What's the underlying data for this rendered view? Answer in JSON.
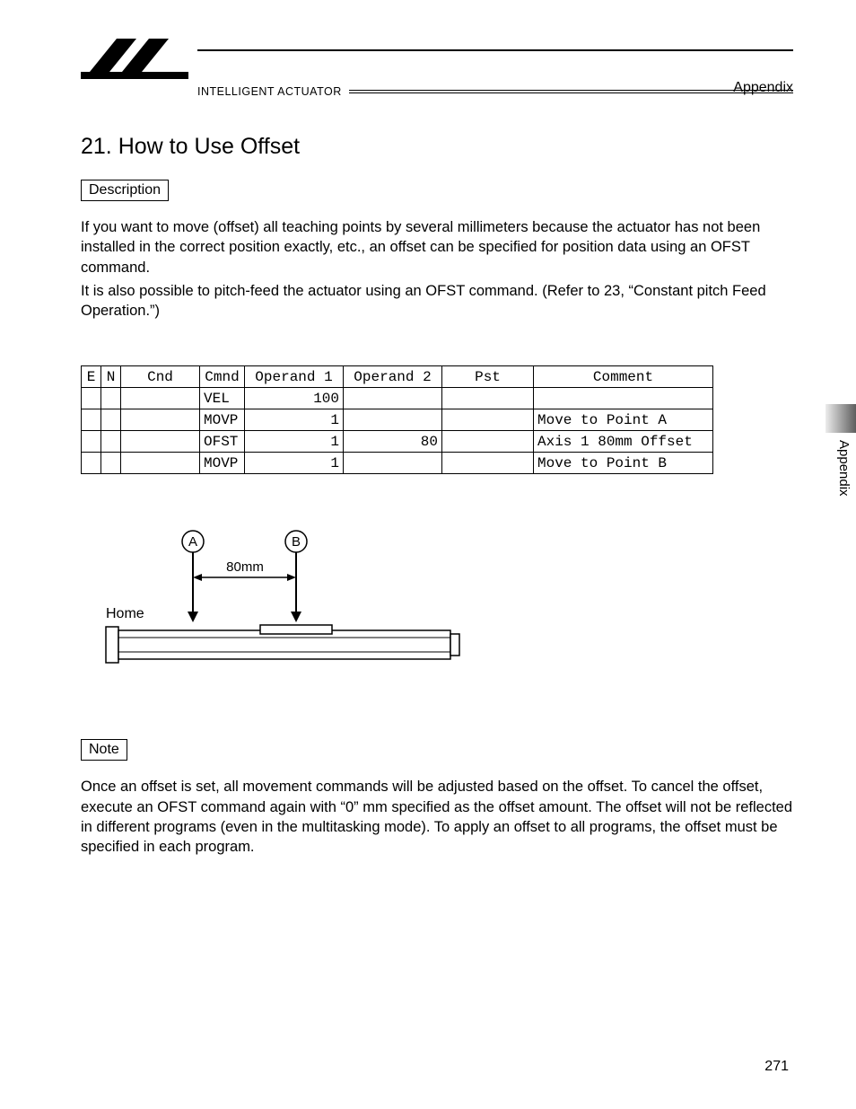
{
  "header": {
    "appendix": "Appendix",
    "brand": "INTELLIGENT ACTUATOR"
  },
  "title": "21.  How to Use Offset",
  "labels": {
    "description": "Description",
    "note": "Note"
  },
  "description_paragraphs": [
    "If you want to move (offset) all teaching points by several millimeters because the actuator has not been installed in the correct position exactly, etc., an offset can be specified for position data using an OFST command.",
    "It is also possible to pitch-feed the actuator using an OFST command. (Refer to 23, “Constant pitch Feed Operation.”)"
  ],
  "table": {
    "headers": {
      "e": "E",
      "n": "N",
      "cnd": "Cnd",
      "cmnd": "Cmnd",
      "op1": "Operand 1",
      "op2": "Operand 2",
      "pst": "Pst",
      "comment": "Comment"
    },
    "rows": [
      {
        "e": "",
        "n": "",
        "cnd": "",
        "cmnd": "VEL",
        "op1": "100",
        "op2": "",
        "pst": "",
        "comment": ""
      },
      {
        "e": "",
        "n": "",
        "cnd": "",
        "cmnd": "MOVP",
        "op1": "1",
        "op2": "",
        "pst": "",
        "comment": "Move to Point A"
      },
      {
        "e": "",
        "n": "",
        "cnd": "",
        "cmnd": "OFST",
        "op1": "1",
        "op2": "80",
        "pst": "",
        "comment": "Axis 1 80mm Offset"
      },
      {
        "e": "",
        "n": "",
        "cnd": "",
        "cmnd": "MOVP",
        "op1": "1",
        "op2": "",
        "pst": "",
        "comment": "Move to Point B"
      }
    ]
  },
  "diagram": {
    "home": "Home",
    "pointA": "A",
    "pointB": "B",
    "distance": "80mm"
  },
  "note_paragraph": "Once an offset is set, all movement commands will be adjusted based on the offset. To cancel the offset, execute an OFST command again with “0” mm specified as the offset amount. The offset will not be reflected in different programs (even in the multitasking mode). To apply an offset to all programs, the offset must be specified in each program.",
  "side_tab": "Appendix",
  "page_number": "271"
}
